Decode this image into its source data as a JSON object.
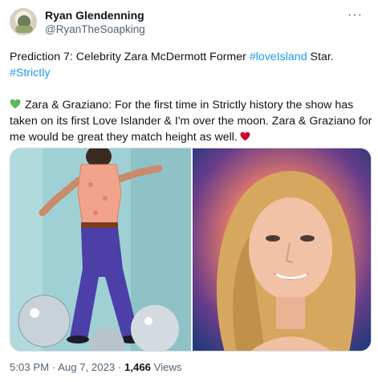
{
  "author": {
    "display_name": "Ryan Glendenning",
    "handle": "@RyanTheSoapking"
  },
  "more_icon": "ellipsis-icon",
  "tweet": {
    "line1_prefix": "Prediction 7: Celebrity Zara McDermott Former ",
    "line1_hashtag": "#loveIsland",
    "line1_suffix": " Star.",
    "line2_hashtag": "#Strictly",
    "line3_text": "Zara & Graziano: For the first time in Strictly history the show has",
    "line4_text": "taken on its first Love Islander &   I'm over the moon. Zara & Graziano for",
    "line5_text": "me would be great they match height as well.",
    "emoji_green_heart": "green-heart-icon",
    "emoji_red_heart": "red-heart-icon"
  },
  "media": {
    "left_image": "dancer-with-disco-balls-photo",
    "right_image": "smiling-woman-portrait-photo"
  },
  "meta": {
    "time": "5:03 PM",
    "separator": " · ",
    "date": "Aug 7, 2023",
    "views_count": "1,466",
    "views_label": " Views"
  },
  "colors": {
    "link": "#1d9bf0",
    "text": "#0f1419",
    "secondary": "#536471",
    "heart_green": "#5cb85c",
    "heart_red": "#d2002a"
  }
}
